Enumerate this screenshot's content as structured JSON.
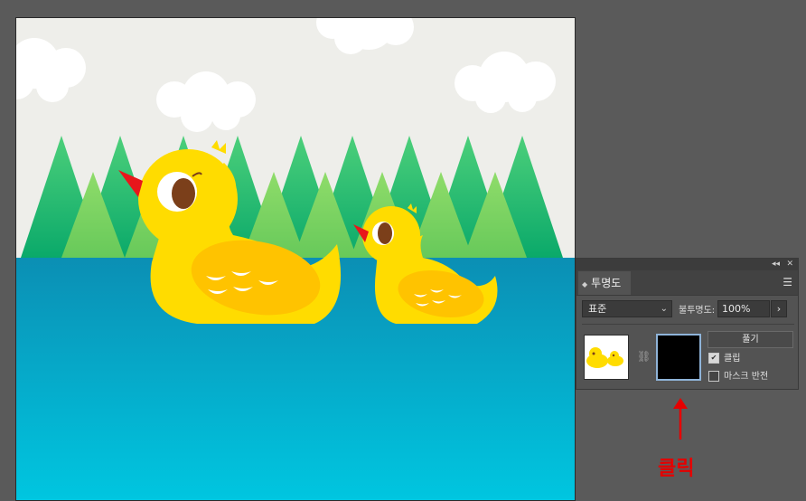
{
  "panel": {
    "collapse_icon": "double-left-arrow-icon",
    "close_icon": "close-icon",
    "tab_label": "투명도",
    "menu_icon": "hamburger-menu-icon",
    "blend_mode": "표준",
    "opacity_label": "불투명도:",
    "opacity_value": "100%",
    "release_button": "풀기",
    "clip_label": "클립",
    "clip_checked": true,
    "invert_label": "마스크 반전",
    "invert_checked": false
  },
  "annotation": {
    "text": "클릭",
    "color": "#e50000"
  },
  "colors": {
    "sky": "#eeeeea",
    "water_top": "#0b8fb4",
    "water_bottom": "#00c6e0",
    "duck_yellow": "#ffdc00",
    "beak_red": "#e8161b"
  }
}
